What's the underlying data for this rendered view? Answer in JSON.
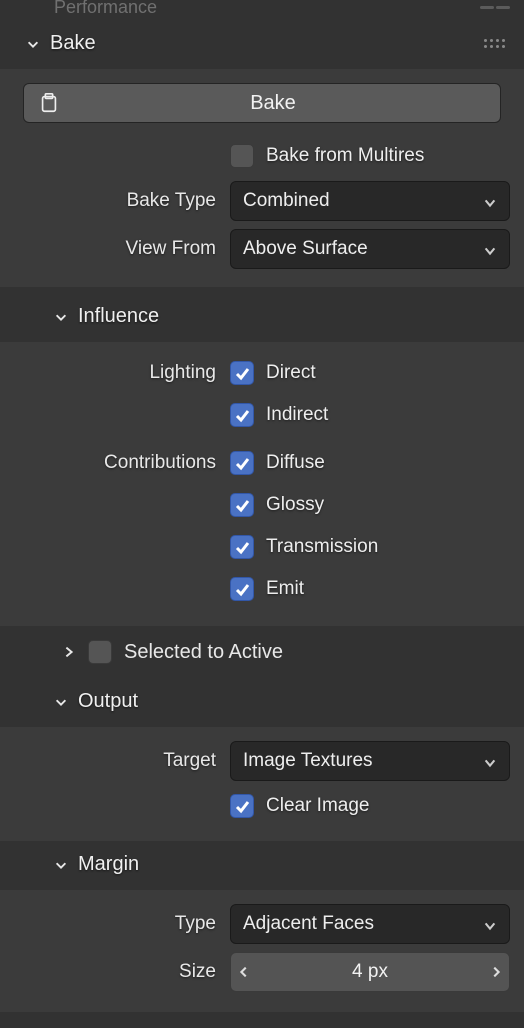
{
  "prev_section": {
    "title": "Performance"
  },
  "bake": {
    "title": "Bake",
    "button": "Bake",
    "from_multires": {
      "label": "Bake from Multires",
      "checked": false
    },
    "bake_type": {
      "label": "Bake Type",
      "value": "Combined"
    },
    "view_from": {
      "label": "View From",
      "value": "Above Surface"
    }
  },
  "influence": {
    "title": "Influence",
    "lighting_label": "Lighting",
    "contributions_label": "Contributions",
    "lighting": [
      {
        "label": "Direct",
        "checked": true
      },
      {
        "label": "Indirect",
        "checked": true
      }
    ],
    "contributions": [
      {
        "label": "Diffuse",
        "checked": true
      },
      {
        "label": "Glossy",
        "checked": true
      },
      {
        "label": "Transmission",
        "checked": true
      },
      {
        "label": "Emit",
        "checked": true
      }
    ]
  },
  "selected_to_active": {
    "label": "Selected to Active",
    "checked": false
  },
  "output": {
    "title": "Output",
    "target": {
      "label": "Target",
      "value": "Image Textures"
    },
    "clear_image": {
      "label": "Clear Image",
      "checked": true
    }
  },
  "margin": {
    "title": "Margin",
    "type": {
      "label": "Type",
      "value": "Adjacent Faces"
    },
    "size": {
      "label": "Size",
      "value": "4 px"
    }
  }
}
